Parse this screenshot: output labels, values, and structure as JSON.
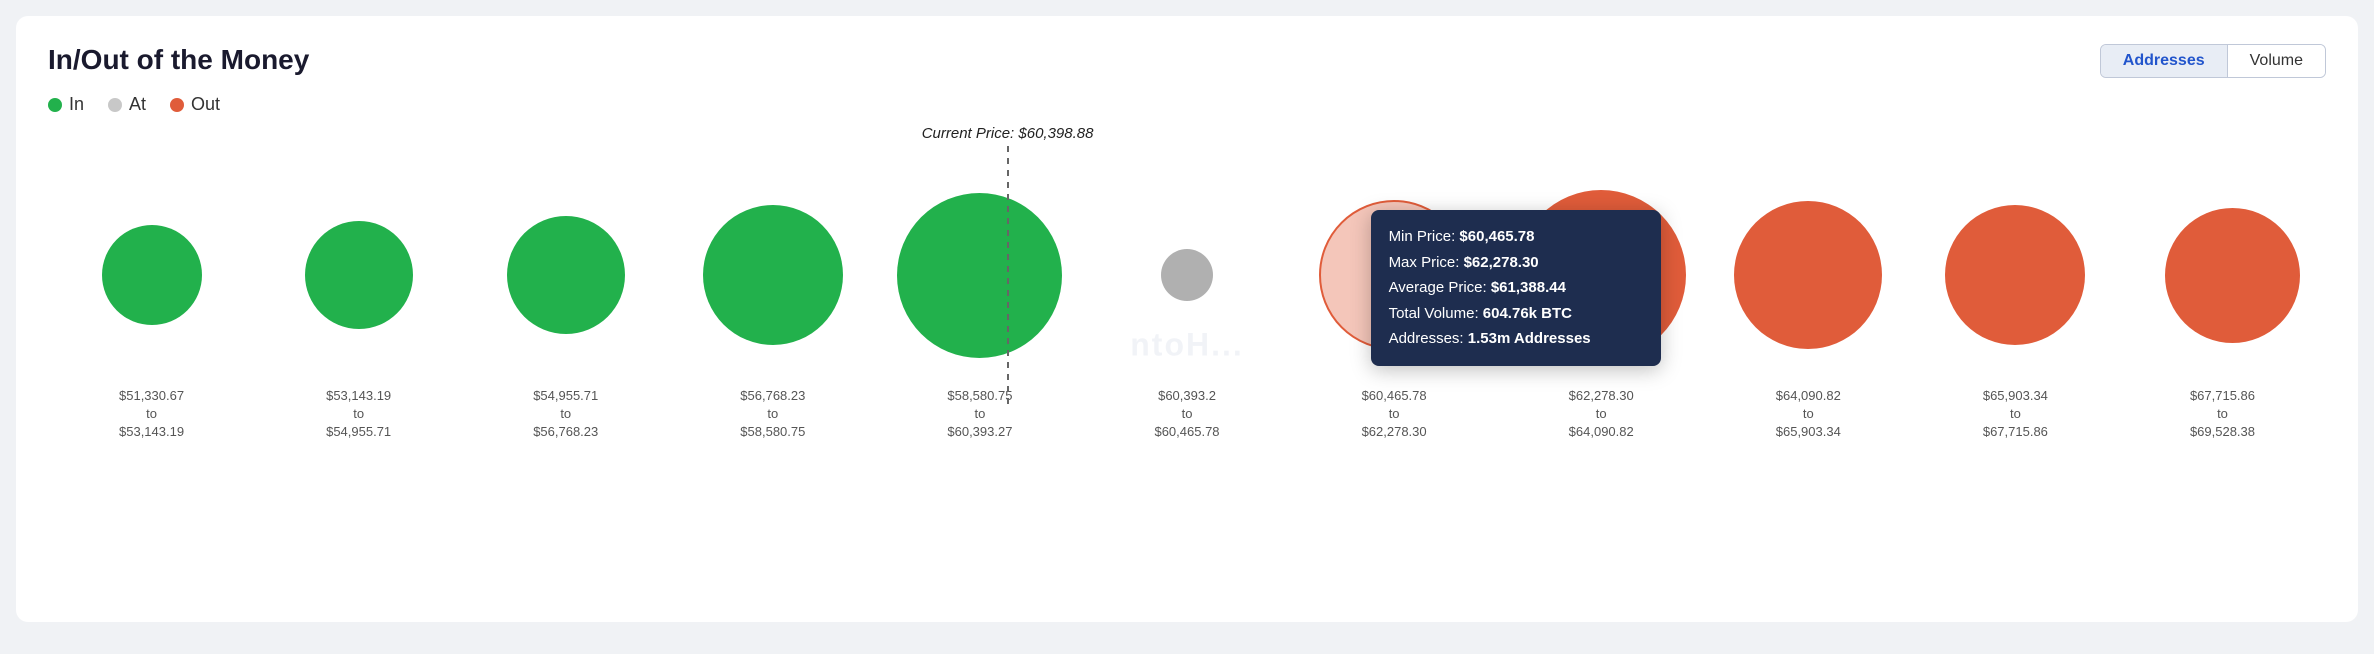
{
  "title": "In/Out of the Money",
  "legend": {
    "in": "In",
    "at": "At",
    "out": "Out"
  },
  "buttons": {
    "addresses": "Addresses",
    "volume": "Volume",
    "active": "addresses"
  },
  "current_price": {
    "label": "Current Price: $60,398.88"
  },
  "bubbles": [
    {
      "id": 0,
      "color": "green",
      "size": 100,
      "x_label_top": "$51,330.67",
      "x_label_mid": "to",
      "x_label_bot": "$53,143.19"
    },
    {
      "id": 1,
      "color": "green",
      "size": 108,
      "x_label_top": "$53,143.19",
      "x_label_mid": "to",
      "x_label_bot": "$54,955.71"
    },
    {
      "id": 2,
      "color": "green",
      "size": 118,
      "x_label_top": "$54,955.71",
      "x_label_mid": "to",
      "x_label_bot": "$56,768.23"
    },
    {
      "id": 3,
      "color": "green",
      "size": 140,
      "x_label_top": "$56,768.23",
      "x_label_mid": "to",
      "x_label_bot": "$58,580.75"
    },
    {
      "id": 4,
      "color": "green",
      "size": 165,
      "x_label_top": "$58,580.75",
      "x_label_mid": "to",
      "x_label_bot": "$60,393.27"
    },
    {
      "id": 5,
      "color": "gray",
      "size": 52,
      "x_label_top": "$60,393.2",
      "x_label_mid": "to",
      "x_label_bot": "$60,465.78"
    },
    {
      "id": 6,
      "color": "red-light",
      "size": 150,
      "x_label_top": "$60,465.78",
      "x_label_mid": "to",
      "x_label_bot": "$62,278.30",
      "has_tooltip": true
    },
    {
      "id": 7,
      "color": "red",
      "size": 170,
      "x_label_top": "$62,278.30",
      "x_label_mid": "to",
      "x_label_bot": "$64,090.82"
    },
    {
      "id": 8,
      "color": "red",
      "size": 148,
      "x_label_top": "$64,090.82",
      "x_label_mid": "to",
      "x_label_bot": "$65,903.34"
    },
    {
      "id": 9,
      "color": "red",
      "size": 140,
      "x_label_top": "$65,903.34",
      "x_label_mid": "to",
      "x_label_bot": "$67,715.86"
    },
    {
      "id": 10,
      "color": "red",
      "size": 135,
      "x_label_top": "$67,715.86",
      "x_label_mid": "to",
      "x_label_bot": "$69,528.38"
    }
  ],
  "tooltip": {
    "min_price_label": "Min Price: ",
    "min_price_value": "$60,465.78",
    "max_price_label": "Max Price: ",
    "max_price_value": "$62,278.30",
    "avg_price_label": "Average Price: ",
    "avg_price_value": "$61,388.44",
    "total_vol_label": "Total Volume: ",
    "total_vol_value": "604.76k BTC",
    "addresses_label": "Addresses: ",
    "addresses_value": "1.53m Addresses"
  },
  "watermark": "ntoH..."
}
